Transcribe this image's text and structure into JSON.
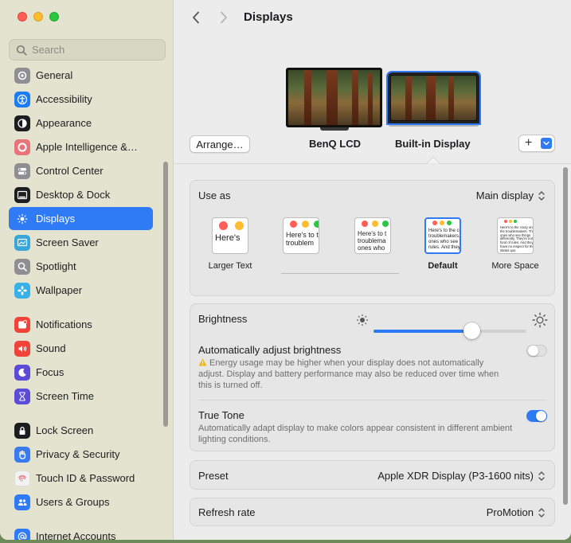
{
  "window": {
    "title": "Displays"
  },
  "search": {
    "placeholder": "Search"
  },
  "sidebar": {
    "items": [
      {
        "label": "General",
        "icon": "gear-icon",
        "color": "#8e8e93"
      },
      {
        "label": "Accessibility",
        "icon": "accessibility-icon",
        "color": "#1e7cf2"
      },
      {
        "label": "Appearance",
        "icon": "appearance-icon",
        "color": "#1d1d1f"
      },
      {
        "label": "Apple Intelligence &…",
        "icon": "apple-intelligence-icon",
        "color": "#e8737b"
      },
      {
        "label": "Control Center",
        "icon": "control-center-icon",
        "color": "#8e8e93"
      },
      {
        "label": "Desktop & Dock",
        "icon": "desktop-dock-icon",
        "color": "#1d1d1f"
      },
      {
        "label": "Displays",
        "icon": "displays-icon",
        "color": "#2f7bf5",
        "active": true
      },
      {
        "label": "Screen Saver",
        "icon": "screen-saver-icon",
        "color": "#38a6d9"
      },
      {
        "label": "Spotlight",
        "icon": "spotlight-icon",
        "color": "#8e8e93"
      },
      {
        "label": "Wallpaper",
        "icon": "wallpaper-icon",
        "color": "#3ab0e8"
      },
      {
        "label": "Notifications",
        "icon": "notifications-icon",
        "color": "#f0443a"
      },
      {
        "label": "Sound",
        "icon": "sound-icon",
        "color": "#f0443a"
      },
      {
        "label": "Focus",
        "icon": "focus-icon",
        "color": "#5b4bd6"
      },
      {
        "label": "Screen Time",
        "icon": "screen-time-icon",
        "color": "#5b4bd6"
      },
      {
        "label": "Lock Screen",
        "icon": "lock-icon",
        "color": "#1d1d1f"
      },
      {
        "label": "Privacy & Security",
        "icon": "hand-icon",
        "color": "#3a7cf0"
      },
      {
        "label": "Touch ID & Password",
        "icon": "fingerprint-icon",
        "color": "#f2f2f2"
      },
      {
        "label": "Users & Groups",
        "icon": "users-icon",
        "color": "#2f7bf5"
      },
      {
        "label": "Internet Accounts",
        "icon": "at-icon",
        "color": "#2f7bf5"
      }
    ]
  },
  "displays": {
    "arrange_label": "Arrange…",
    "monitors": [
      {
        "label": "BenQ LCD"
      },
      {
        "label": "Built-in Display",
        "selected": true
      }
    ],
    "add_label": "+"
  },
  "use_as": {
    "label": "Use as",
    "value": "Main display"
  },
  "resolution": {
    "options": [
      {
        "caption": "Larger Text",
        "sample": "Here's"
      },
      {
        "caption": "",
        "sample": "Here's to t troublem"
      },
      {
        "caption": "",
        "sample": "Here's to t troublema ones who"
      },
      {
        "caption": "Default",
        "sample": "Here's to the cr troublemakers. ones who see th rules. And they",
        "selected": true
      },
      {
        "caption": "More Space",
        "sample": "Here's to the crazy ones the troublemakers. The ones who see things differently. They're not fond of rules. And they have no respect for the status quo."
      }
    ]
  },
  "brightness": {
    "label": "Brightness",
    "level": 0.64
  },
  "auto_brightness": {
    "label": "Automatically adjust brightness",
    "warning": "Energy usage may be higher when your display does not automatically adjust. Display and battery performance may also be reduced over time when this is turned off.",
    "enabled": false
  },
  "true_tone": {
    "label": "True Tone",
    "description": "Automatically adapt display to make colors appear consistent in different ambient lighting conditions.",
    "enabled": true
  },
  "preset": {
    "label": "Preset",
    "value": "Apple XDR Display (P3-1600 nits)"
  },
  "refresh_rate": {
    "label": "Refresh rate",
    "value": "ProMotion"
  },
  "colors": {
    "accent": "#2f7bf5",
    "sidebar_bg": "#e4e3cf"
  }
}
